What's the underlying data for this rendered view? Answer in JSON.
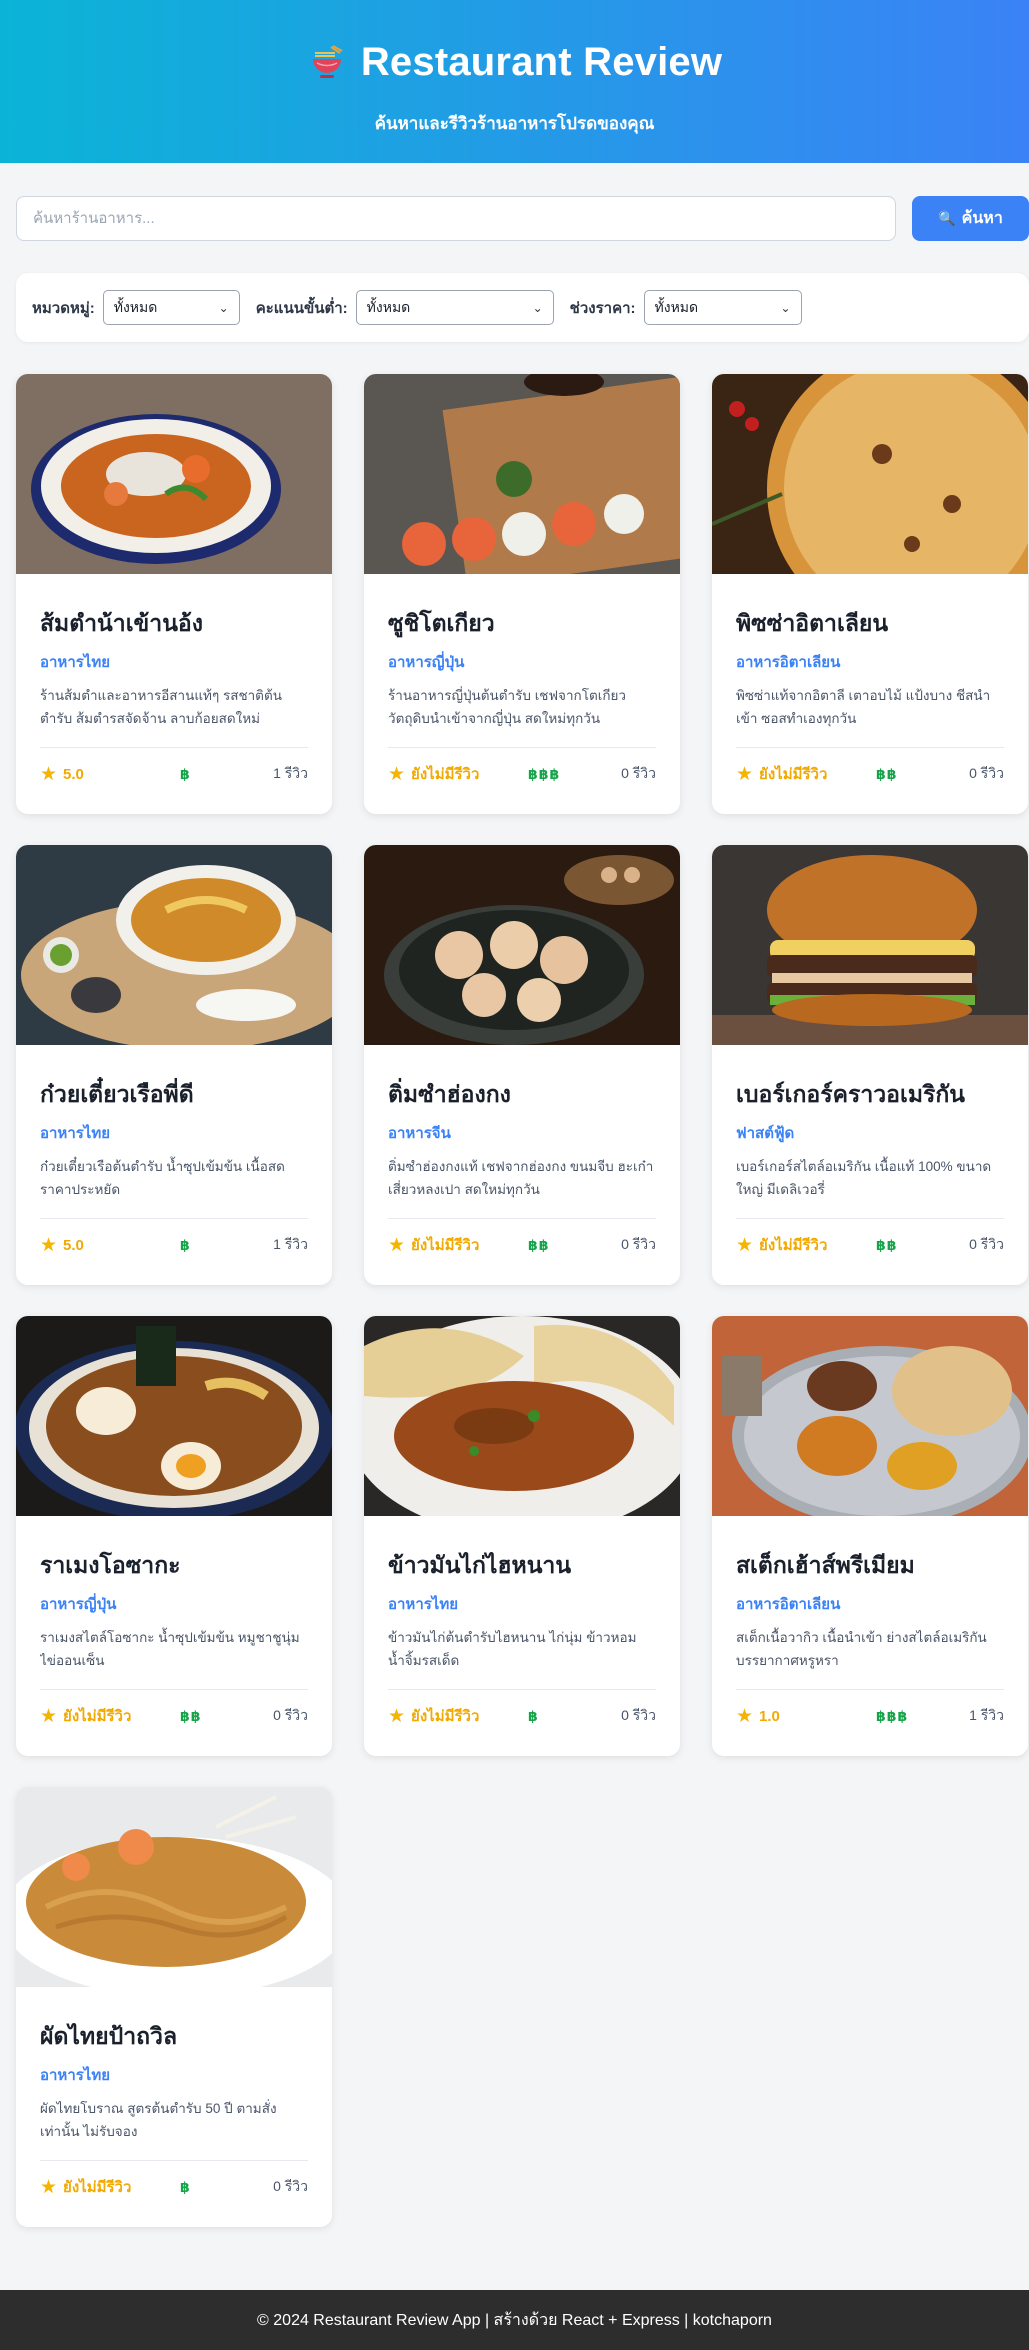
{
  "header": {
    "title": "Restaurant Review",
    "subtitle": "ค้นหาและรีวิวร้านอาหารโปรดของคุณ",
    "icon": "noodle-bowl-icon"
  },
  "search": {
    "placeholder": "ค้นหาร้านอาหาร...",
    "value": "",
    "button_label": "ค้นหา",
    "button_icon": "magnifier-icon"
  },
  "filters": {
    "category_label": "หมวดหมู่:",
    "category_value": "ทั้งหมด",
    "min_rating_label": "คะแนนขั้นต่ำ:",
    "min_rating_value": "ทั้งหมด",
    "price_label": "ช่วงราคา:",
    "price_value": "ทั้งหมด"
  },
  "restaurants": [
    {
      "name": "ส้มตำน้าเข้านอ้ง",
      "category": "อาหารไทย",
      "description": "ร้านส้มตำและอาหารอีสานแท้ๆ รสชาติต้นตำรับ ส้มตำรสจัดจ้าน ลาบก้อยสดใหม่",
      "rating": "5.0",
      "price": "฿",
      "reviews": "1 รีวิว",
      "image": "shrimp-curry-bowl"
    },
    {
      "name": "ซูชิโตเกียว",
      "category": "อาหารญี่ปุ่น",
      "description": "ร้านอาหารญี่ปุ่นต้นตำรับ เชฟจากโตเกียว วัตถุดิบนำเข้าจากญี่ปุ่น สดใหม่ทุกวัน",
      "rating": "ยังไม่มีรีวิว",
      "price": "฿฿฿",
      "reviews": "0 รีวิว",
      "image": "sushi-rolls"
    },
    {
      "name": "พิซซ่าอิตาเลียน",
      "category": "อาหารอิตาเลียน",
      "description": "พิซซ่าแท้จากอิตาลี เตาอบไม้ แป้งบาง ชีสนำเข้า ซอสทำเองทุกวัน",
      "rating": "ยังไม่มีรีวิว",
      "price": "฿฿",
      "reviews": "0 รีวิว",
      "image": "pizza"
    },
    {
      "name": "ก๋วยเตี๋ยวเรือพี่ดี",
      "category": "อาหารไทย",
      "description": "ก๋วยเตี๋ยวเรือต้นตำรับ น้ำซุปเข้มข้น เนื้อสด ราคาประหยัด",
      "rating": "5.0",
      "price": "฿",
      "reviews": "1 รีวิว",
      "image": "noodle-soup"
    },
    {
      "name": "ติ่มซำฮ่องกง",
      "category": "อาหารจีน",
      "description": "ติ่มซำฮ่องกงแท้ เชฟจากฮ่องกง ขนมจีบ ฮะเก๋า เสี่ยวหลงเปา สดใหม่ทุกวัน",
      "rating": "ยังไม่มีรีวิว",
      "price": "฿฿",
      "reviews": "0 รีวิว",
      "image": "dim-sum"
    },
    {
      "name": "เบอร์เกอร์คราวอเมริกัน",
      "category": "ฟาสต์ฟู้ด",
      "description": "เบอร์เกอร์สไตล์อเมริกัน เนื้อแท้ 100% ขนาดใหญ่ มีเดลิเวอรี่",
      "rating": "ยังไม่มีรีวิว",
      "price": "฿฿",
      "reviews": "0 รีวิว",
      "image": "burger"
    },
    {
      "name": "ราเมงโอซากะ",
      "category": "อาหารญี่ปุ่น",
      "description": "ราเมงสไตล์โอซากะ น้ำซุปเข้มข้น หมูชาชูนุ่ม ไข่ออนเซ็น",
      "rating": "ยังไม่มีรีวิว",
      "price": "฿฿",
      "reviews": "0 รีวิว",
      "image": "ramen"
    },
    {
      "name": "ข้าวมันไก่ไฮหนาน",
      "category": "อาหารไทย",
      "description": "ข้าวมันไก่ต้นตำรับไฮหนาน ไก่นุ่ม ข้าวหอม น้ำจิ้มรสเด็ด",
      "rating": "ยังไม่มีรีวิว",
      "price": "฿",
      "reviews": "0 รีวิว",
      "image": "curry-naan"
    },
    {
      "name": "สเต็กเฮ้าส์พรีเมียม",
      "category": "อาหารอิตาเลียน",
      "description": "สเต็กเนื้อวากิว เนื้อนำเข้า ย่างสไตล์อเมริกัน บรรยากาศหรูหรา",
      "rating": "1.0",
      "price": "฿฿฿",
      "reviews": "1 รีวิว",
      "image": "thali-tray"
    },
    {
      "name": "ผัดไทยป้าถวิล",
      "category": "อาหารไทย",
      "description": "ผัดไทยโบราณ สูตรต้นตำรับ 50 ปี ตามสั่ง เท่านั้น ไม่รับจอง",
      "rating": "ยังไม่มีรีวิว",
      "price": "฿",
      "reviews": "0 รีวิว",
      "image": "pad-thai"
    }
  ],
  "footer": {
    "text": "© 2024 Restaurant Review App | สร้างด้วย React + Express | kotchaporn"
  }
}
